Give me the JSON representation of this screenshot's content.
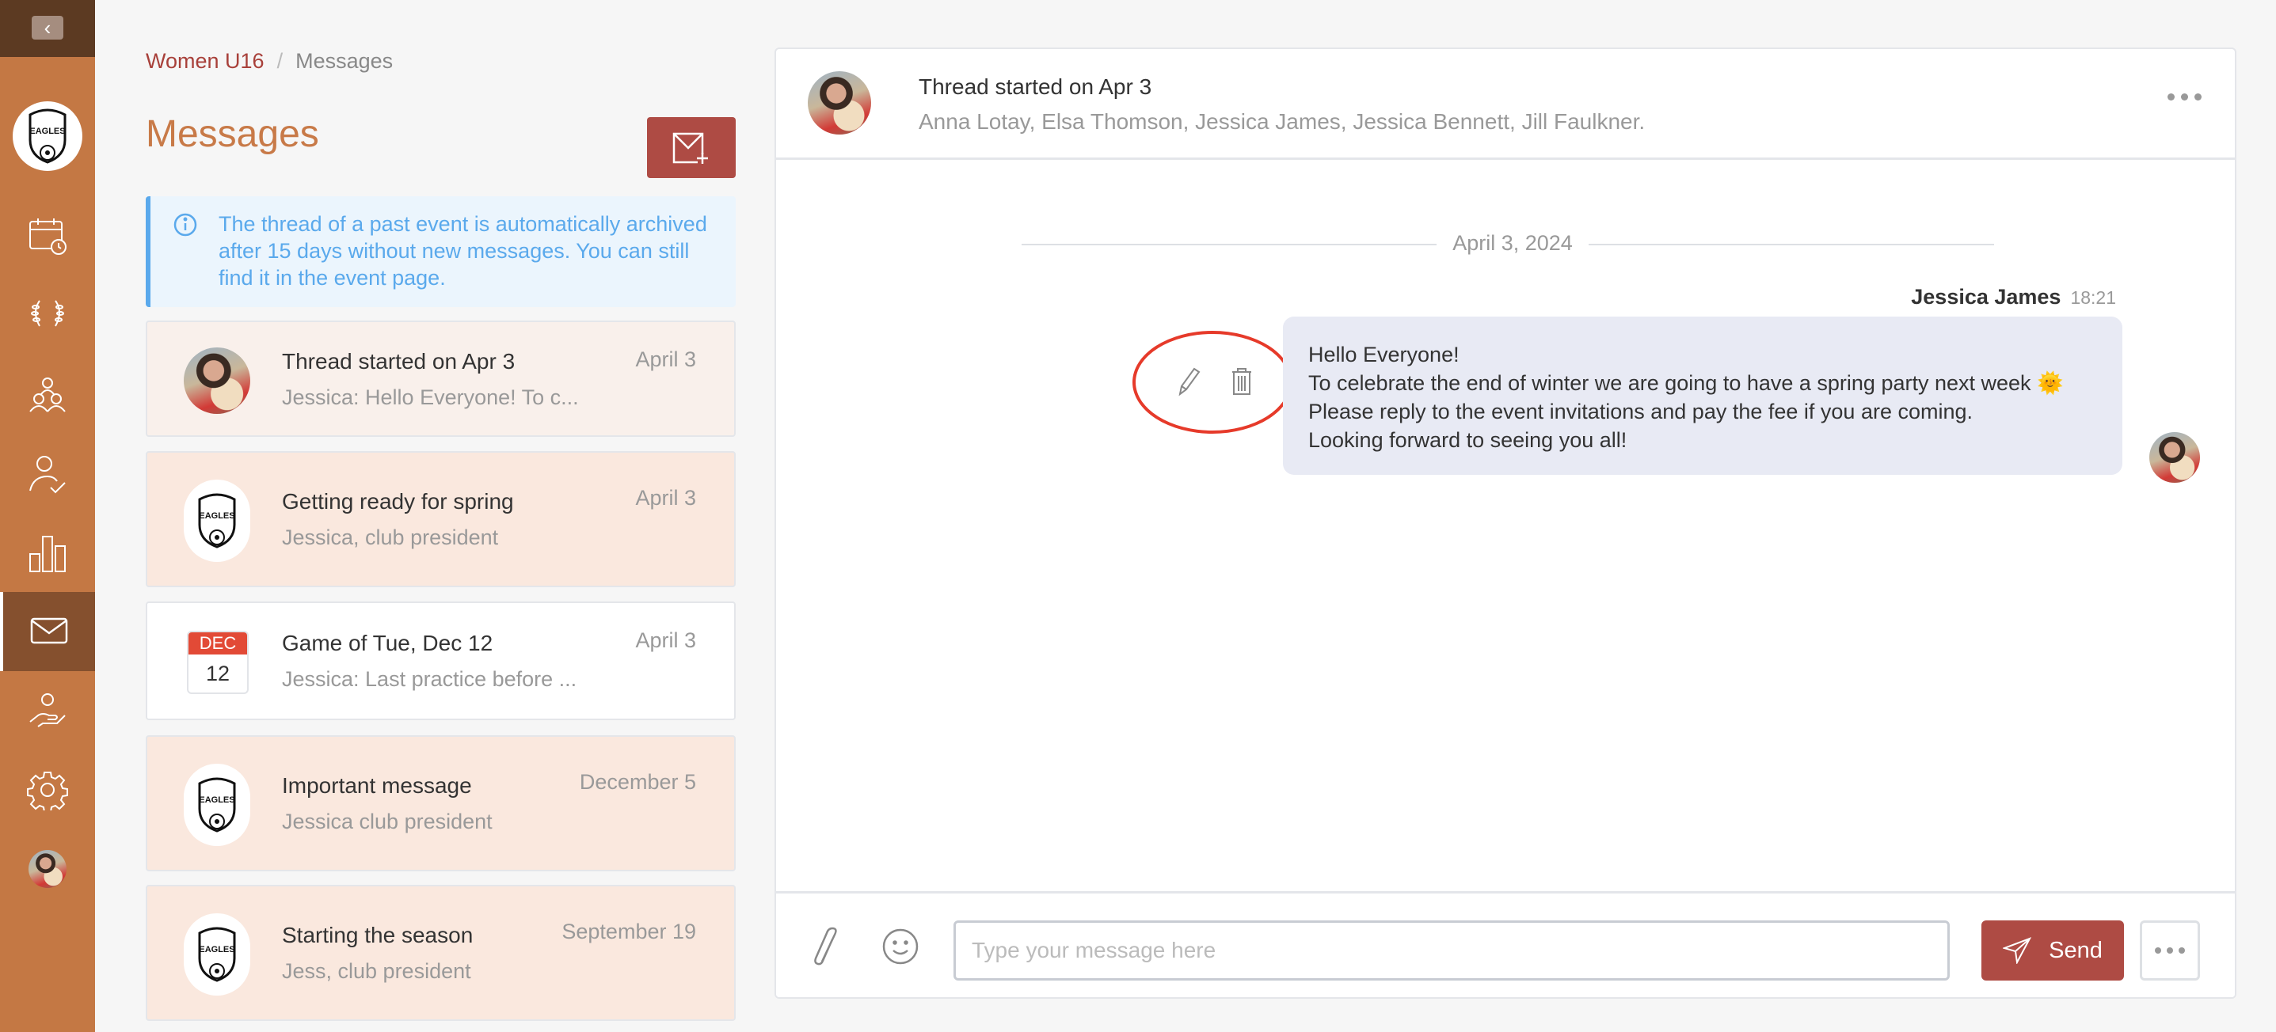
{
  "sidebar": {
    "back_icon": "chevron-left-icon",
    "club_logo": "EAGLES",
    "items": [
      {
        "icon": "calendar-clock-icon",
        "active": false
      },
      {
        "icon": "laurel-icon",
        "active": false
      },
      {
        "icon": "team-icon",
        "active": false
      },
      {
        "icon": "user-check-icon",
        "active": false
      },
      {
        "icon": "bar-chart-icon",
        "active": false
      },
      {
        "icon": "mail-icon",
        "active": true
      },
      {
        "icon": "hand-user-icon",
        "active": false
      },
      {
        "icon": "gear-icon",
        "active": false
      },
      {
        "icon": "user-avatar",
        "active": false
      }
    ]
  },
  "breadcrumb": {
    "parent": "Women U16",
    "separator": "/",
    "current": "Messages"
  },
  "page_title": "Messages",
  "compose_button_icon": "mail-plus-icon",
  "info": {
    "icon": "info-icon",
    "text": "The thread of a past event is automatically archived after 15 days without new messages. You can still find it in the event page."
  },
  "threads": [
    {
      "title": "Thread started on Apr 3",
      "subtitle": "Jessica: Hello Everyone! To c...",
      "date": "April 3",
      "avatar": "user-photo",
      "bg": "#f9f0eb"
    },
    {
      "title": "Getting ready for spring",
      "subtitle": "Jessica, club president",
      "date": "April 3",
      "avatar": "club-logo",
      "bg": "#fae8de"
    },
    {
      "title": "Game of Tue, Dec 12",
      "subtitle": "Jessica: Last practice before ...",
      "date": "April 3",
      "avatar": "calendar",
      "cal_month": "DEC",
      "cal_day": "12",
      "bg": "#ffffff"
    },
    {
      "title": "Important message",
      "subtitle": "Jessica club president",
      "date": "December 5",
      "avatar": "club-logo",
      "bg": "#fae8de"
    },
    {
      "title": "Starting the season",
      "subtitle": "Jess, club president",
      "date": "September 19",
      "avatar": "club-logo",
      "bg": "#fae8de"
    }
  ],
  "conversation": {
    "title": "Thread started on Apr 3",
    "participants": "Anna Lotay, Elsa Thomson, Jessica James, Jessica Bennett, Jill Faulkner.",
    "date_divider": "April 3, 2024",
    "message": {
      "sender": "Jessica James",
      "time": "18:21",
      "lines": [
        "Hello Everyone!",
        "To celebrate the end of winter we are going to have a spring party next week 🌞",
        "Please reply to the event invitations and pay the fee if you are coming.",
        "Looking forward to seeing you all!"
      ]
    },
    "composer": {
      "placeholder": "Type your message here",
      "value": "",
      "send_label": "Send"
    }
  },
  "colors": {
    "sidebar": "#c47844",
    "sidebar_dark": "#5c3a22",
    "accent": "#ae4b44",
    "title": "#c87a48",
    "info": "#5aa9ec",
    "highlight_ring": "#e63a2a"
  }
}
